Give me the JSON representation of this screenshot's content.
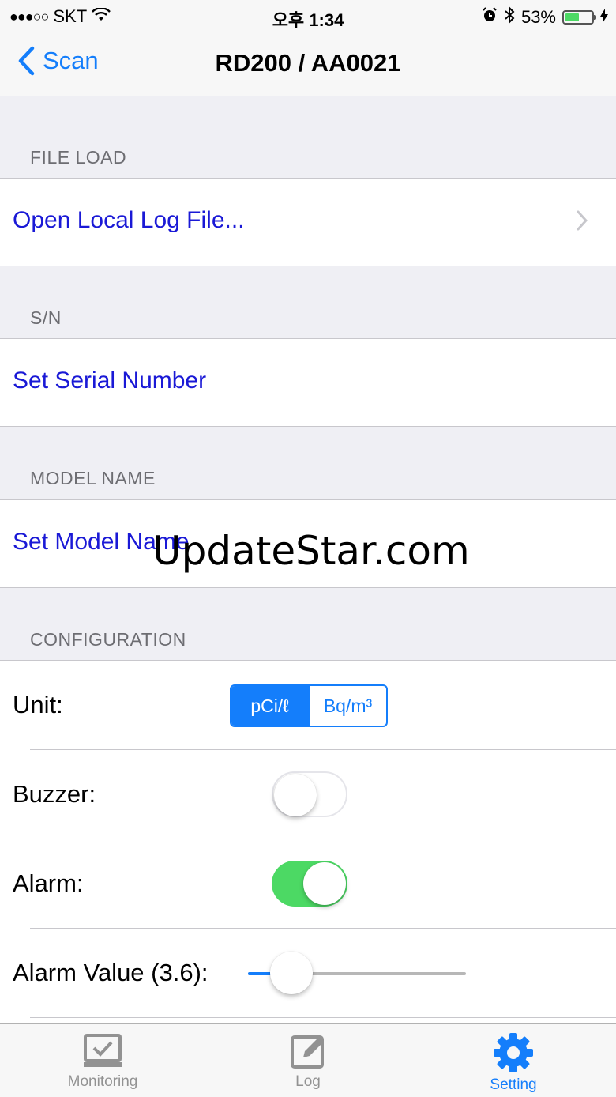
{
  "status_bar": {
    "carrier": "SKT",
    "time": "오후 1:34",
    "battery_percent": "53%",
    "battery_level": 0.53
  },
  "nav": {
    "back_label": "Scan",
    "title": "RD200 / AA0021"
  },
  "sections": {
    "file_load": {
      "header": "FILE LOAD",
      "item": "Open Local Log File..."
    },
    "sn": {
      "header": "S/N",
      "item": "Set Serial Number"
    },
    "model_name": {
      "header": "MODEL NAME",
      "item": "Set Model Name"
    },
    "configuration": {
      "header": "CONFIGURATION",
      "unit_label": "Unit:",
      "unit_options": [
        "pCi/ℓ",
        "Bq/m³"
      ],
      "unit_selected": "pCi/ℓ",
      "buzzer_label": "Buzzer:",
      "buzzer_on": false,
      "alarm_label": "Alarm:",
      "alarm_on": true,
      "alarm_value_label": "Alarm Value (3.6):",
      "alarm_slider_fraction": 0.2
    }
  },
  "watermark": "UpdateStar.com",
  "tabs": [
    {
      "label": "Monitoring",
      "icon": "monitor-check-icon",
      "active": false
    },
    {
      "label": "Log",
      "icon": "edit-icon",
      "active": false
    },
    {
      "label": "Setting",
      "icon": "gear-icon",
      "active": true
    }
  ],
  "colors": {
    "accent": "#147efb",
    "link": "#1a19d6",
    "switch_on": "#4cd964",
    "background": "#efeff4"
  }
}
